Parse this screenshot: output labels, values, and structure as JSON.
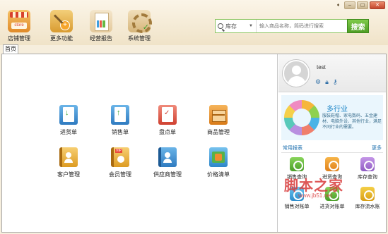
{
  "window": {
    "controls": {
      "skin": "♦",
      "minimize": "–",
      "maximize": "▢",
      "close": "✕"
    }
  },
  "toolbar": {
    "items": [
      {
        "label": "店铺管理",
        "icon": "store-icon"
      },
      {
        "label": "更多功能",
        "icon": "more-functions-icon"
      },
      {
        "label": "经营报告",
        "icon": "business-report-icon"
      },
      {
        "label": "系统管理",
        "icon": "system-settings-icon"
      }
    ]
  },
  "search": {
    "category": "库存",
    "placeholder": "输入商品名称，简码进行搜索",
    "button": "搜索"
  },
  "tabs": [
    {
      "label": "首页",
      "active": true
    }
  ],
  "main": {
    "functions": [
      {
        "label": "进货单",
        "icon": "purchase-order-icon"
      },
      {
        "label": "销售单",
        "icon": "sales-order-icon"
      },
      {
        "label": "盘点单",
        "icon": "stocktake-order-icon"
      },
      {
        "label": "商品管理",
        "icon": "goods-management-icon"
      },
      {
        "label": "客户管理",
        "icon": "customer-management-icon"
      },
      {
        "label": "会员管理",
        "icon": "member-management-icon"
      },
      {
        "label": "供应商管理",
        "icon": "supplier-management-icon"
      },
      {
        "label": "价格清单",
        "icon": "price-list-icon"
      }
    ]
  },
  "user": {
    "name": "test",
    "icons": [
      "settings-icon",
      "lock-icon",
      "key-icon"
    ]
  },
  "industry": {
    "title": "多行业",
    "description": "服装鞋帽、家电数码、五金建材、电脑外设、其他行业，满足不同行业的需要。"
  },
  "quick_reports": {
    "title": "常用报表",
    "more": "更多",
    "items": [
      {
        "label": "销售查询",
        "icon": "sales-query-icon"
      },
      {
        "label": "进货查询",
        "icon": "purchase-query-icon"
      },
      {
        "label": "库存查询",
        "icon": "stock-query-icon"
      },
      {
        "label": "销售对账单",
        "icon": "sales-statement-icon"
      },
      {
        "label": "进货对账单",
        "icon": "purchase-statement-icon"
      },
      {
        "label": "库存流水账",
        "icon": "stock-ledger-icon"
      }
    ]
  },
  "watermark": {
    "main": "脚本之家",
    "sub": "www.jb51.net"
  },
  "colors": {
    "accent": "#4f9d25",
    "brand": "#1c6fae",
    "background": "#f6eedd"
  }
}
